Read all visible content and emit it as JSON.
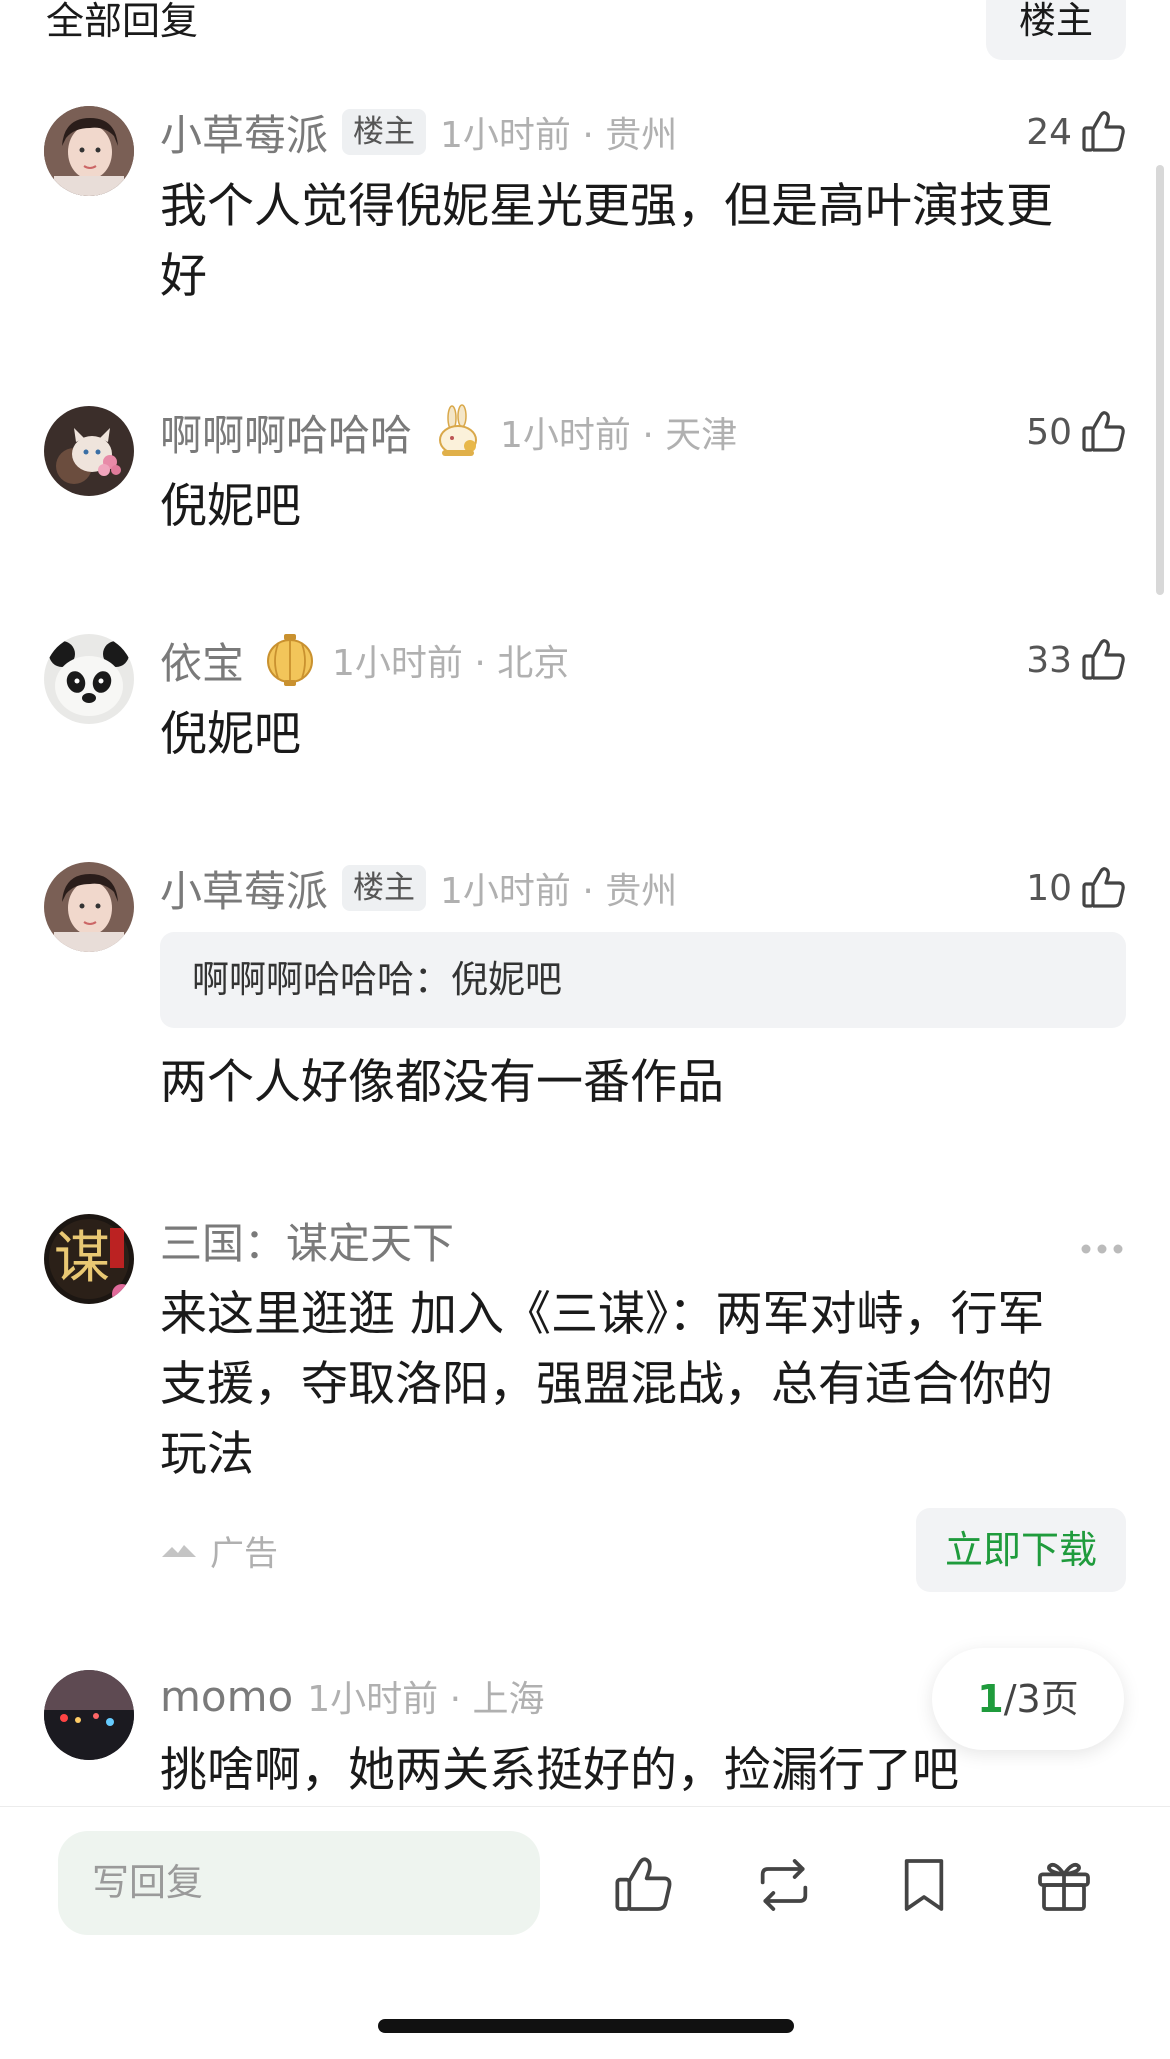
{
  "header": {
    "title": "全部回复",
    "owner_filter": "楼主"
  },
  "comments": [
    {
      "username": "小草莓派",
      "badge": "楼主",
      "time_location": "1小时前 · 贵州",
      "likes": "24",
      "text_lines": [
        "我个人觉得倪妮星光更强，但是高叶演技更",
        "好"
      ]
    },
    {
      "username": "啊啊啊哈哈哈",
      "medal": "rabbit-medal-icon",
      "time_location": "1小时前 · 天津",
      "likes": "50",
      "text_lines": [
        "倪妮吧"
      ]
    },
    {
      "username": "依宝",
      "medal": "lantern-medal-icon",
      "time_location": "1小时前 · 北京",
      "likes": "33",
      "text_lines": [
        "倪妮吧"
      ]
    },
    {
      "username": "小草莓派",
      "badge": "楼主",
      "time_location": "1小时前 · 贵州",
      "likes": "10",
      "quote": "啊啊啊哈哈哈：倪妮吧",
      "text_lines": [
        "两个人好像都没有一番作品"
      ]
    }
  ],
  "ad": {
    "name": "三国：谋定天下",
    "text_lines": [
      "来这里逛逛 加入《三谋》：两军对峙，行军",
      "支援，夺取洛阳，强盟混战，总有适合你的",
      "玩法"
    ],
    "label": "广告",
    "cta": "立即下载",
    "avatar_char": "谋"
  },
  "last_comment": {
    "username": "momo",
    "time_location": "1小时前 · 上海",
    "text": "挑啥啊，她两关系挺好的，捡漏行了吧"
  },
  "pagination": {
    "current": "1",
    "rest": "/3页"
  },
  "bottom_bar": {
    "reply_placeholder": "写回复",
    "icons": [
      "like-icon",
      "repost-icon",
      "bookmark-icon",
      "gift-icon"
    ]
  },
  "colors": {
    "accent_green": "#1f9b3c",
    "muted": "#b0b0b0",
    "pill_bg": "#f2f3f5"
  }
}
